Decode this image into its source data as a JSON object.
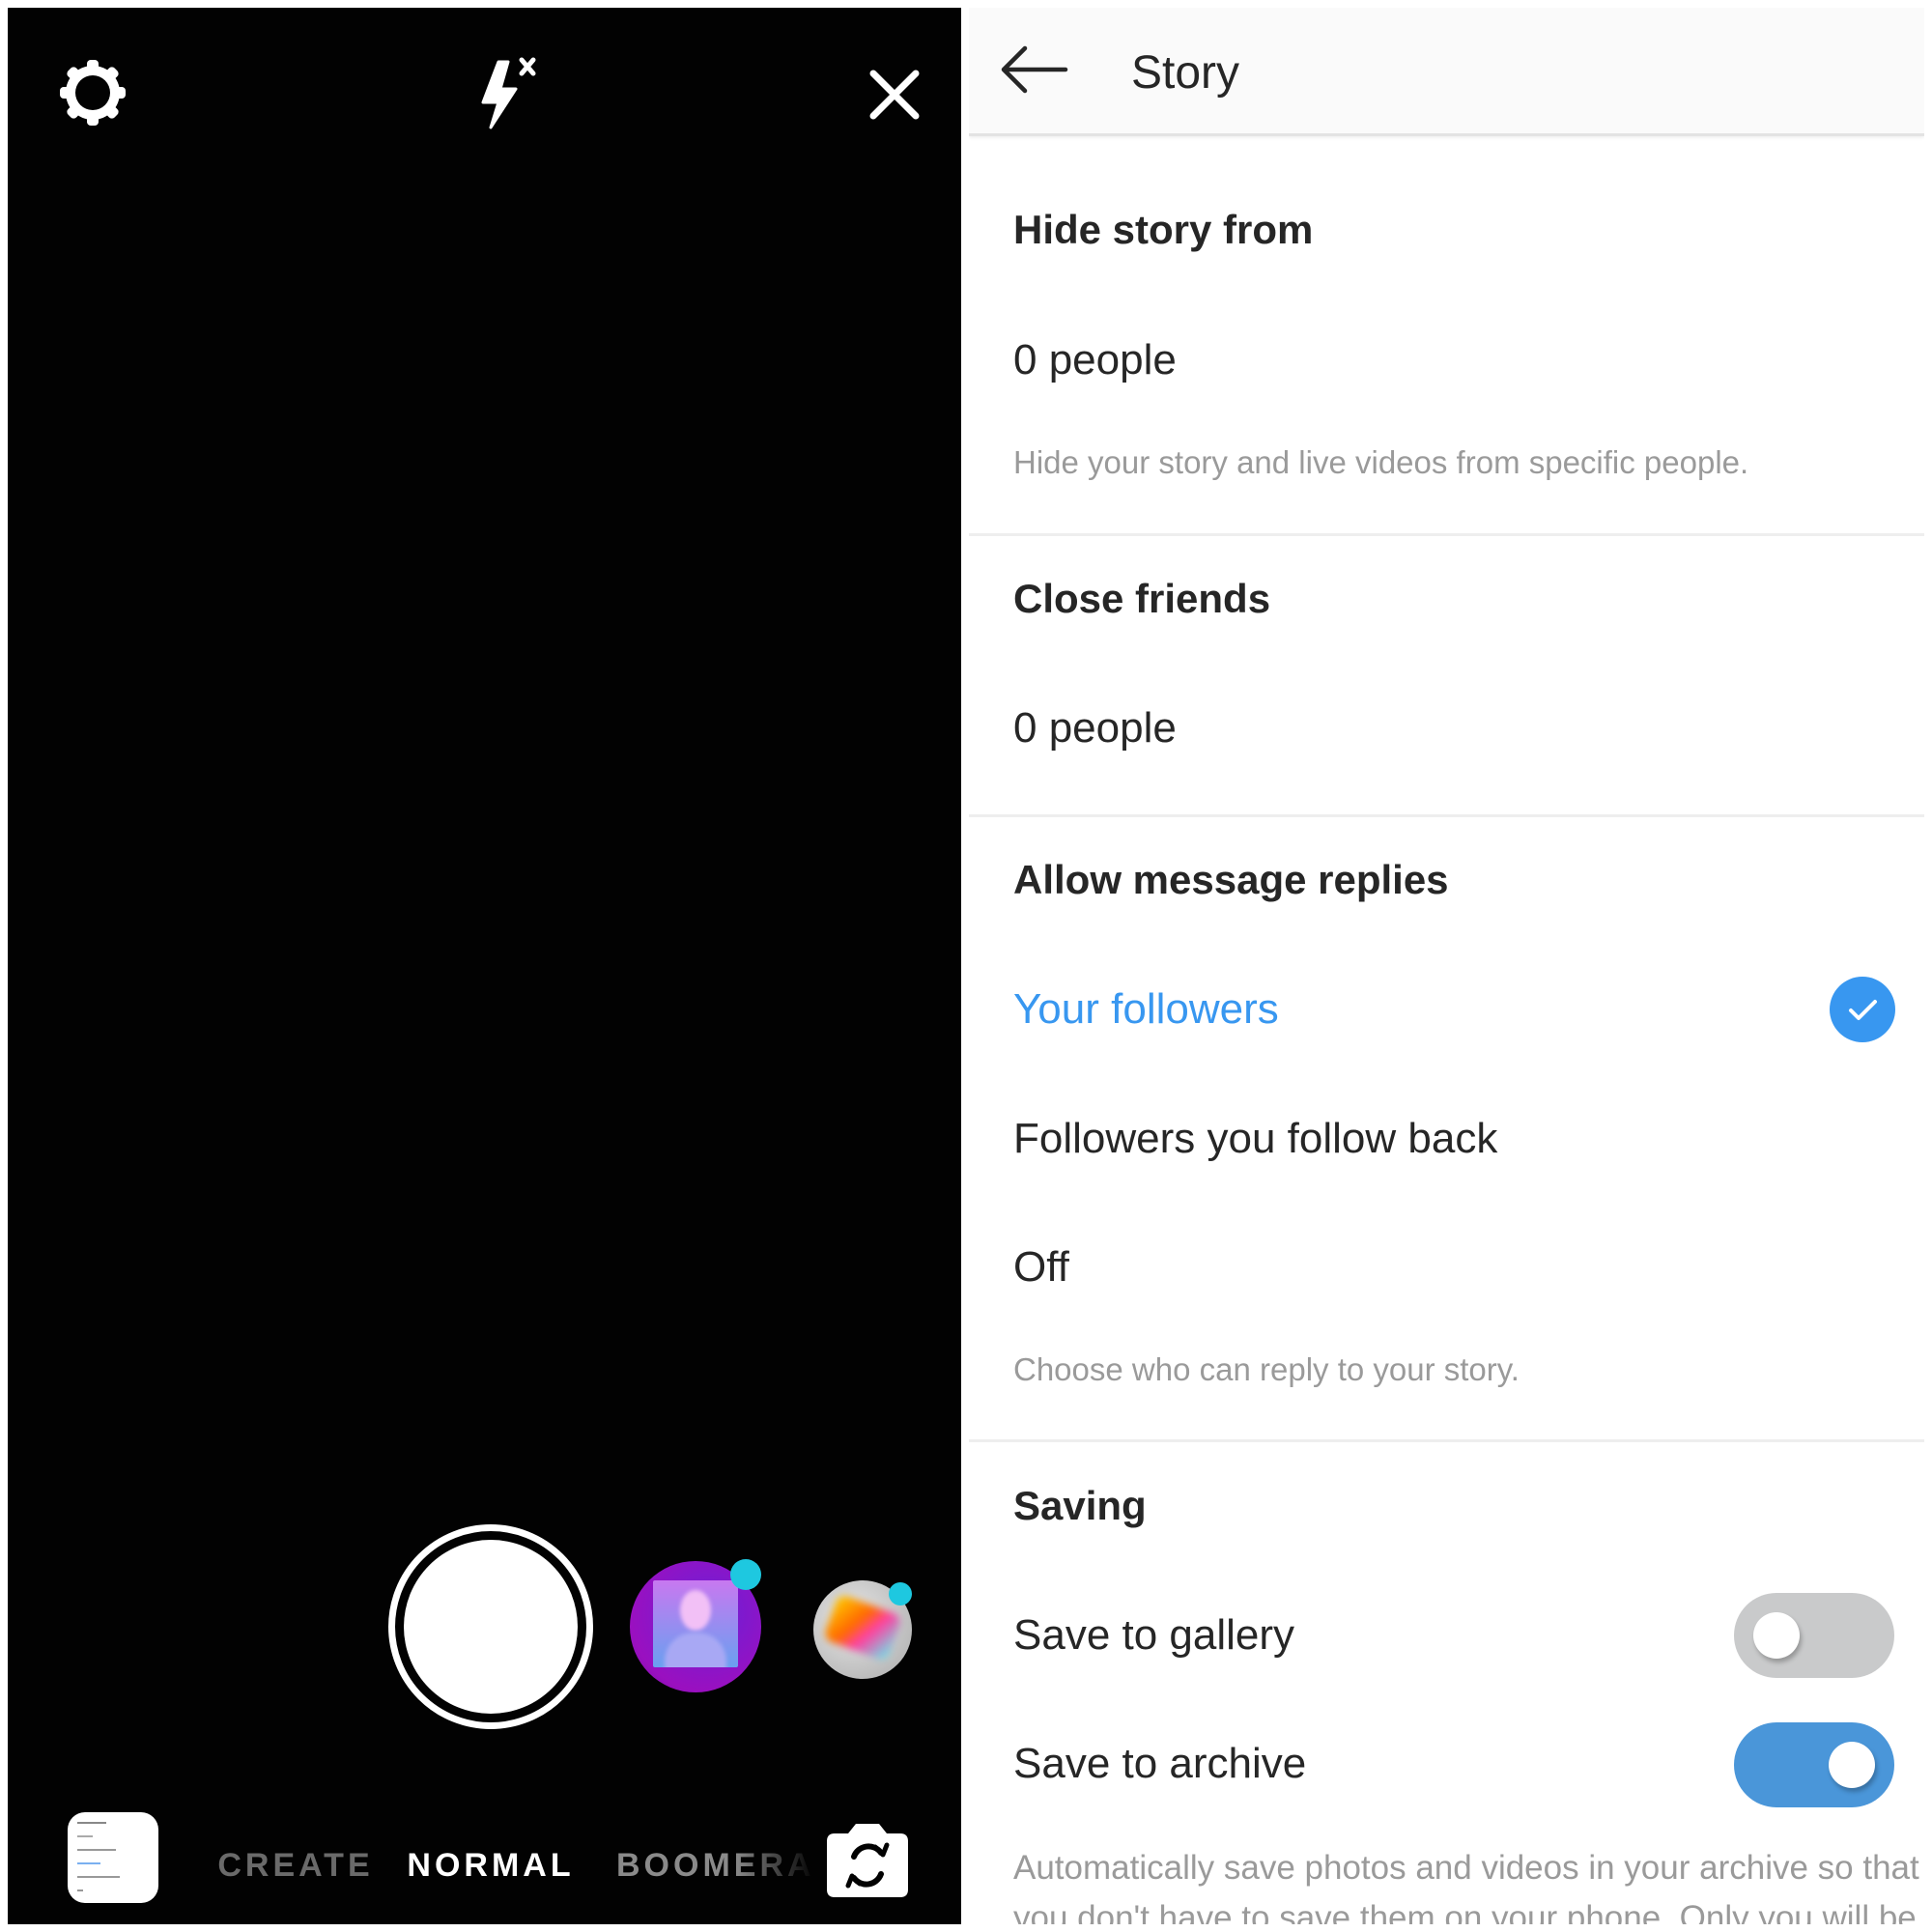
{
  "camera": {
    "top_icons": {
      "settings": "gear-icon",
      "flash": "flash-off-icon",
      "close": "close-icon"
    },
    "capture": {
      "shutter": "shutter-button",
      "effects": [
        {
          "name": "face-effect",
          "has_new_badge": true
        },
        {
          "name": "color-effect",
          "has_new_badge": true
        }
      ]
    },
    "modes": [
      {
        "label": "CREATE",
        "selected": false
      },
      {
        "label": "NORMAL",
        "selected": true
      },
      {
        "label": "BOOMERA",
        "selected": false
      }
    ],
    "gallery_thumbnail": "gallery-thumbnail",
    "flip_camera": "flip-camera-icon"
  },
  "settings": {
    "header": {
      "back_icon": "back-arrow-icon",
      "title": "Story"
    },
    "sections": {
      "hide_story": {
        "heading": "Hide story from",
        "value": "0 people",
        "description": "Hide your story and live videos from specific people."
      },
      "close_friends": {
        "heading": "Close friends",
        "value": "0 people"
      },
      "message_replies": {
        "heading": "Allow message replies",
        "options": [
          {
            "label": "Your followers",
            "selected": true
          },
          {
            "label": "Followers you follow back",
            "selected": false
          },
          {
            "label": "Off",
            "selected": false
          }
        ],
        "description": "Choose who can reply to your story."
      },
      "saving": {
        "heading": "Saving",
        "toggles": [
          {
            "label": "Save to gallery",
            "on": false
          },
          {
            "label": "Save to archive",
            "on": true
          }
        ],
        "description_line1": "Automatically save photos and videos in your archive so that",
        "description_line2": "you don't have to save them on your phone. Only you will be"
      }
    },
    "colors": {
      "accent": "#3897f0",
      "toggle_on": "#4a96d9",
      "toggle_off": "#c9cacb",
      "text": "#262626",
      "muted": "#9a9a9a"
    }
  }
}
